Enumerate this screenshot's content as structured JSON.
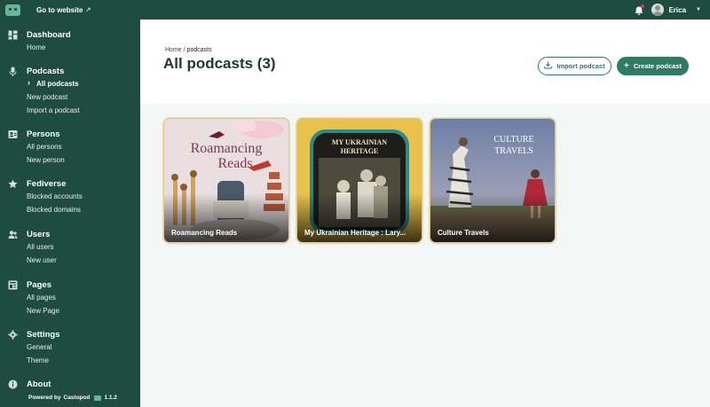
{
  "topbar": {
    "go_to_website": "Go to website",
    "user_name": "Erica"
  },
  "sidebar": {
    "sections": [
      {
        "title": "Dashboard",
        "icon": "dashboard-icon",
        "items": [
          "Home"
        ]
      },
      {
        "title": "Podcasts",
        "icon": "microphone-icon",
        "items": [
          "All podcasts",
          "New podcast",
          "Import a podcast"
        ],
        "active": "All podcasts"
      },
      {
        "title": "Persons",
        "icon": "person-card-icon",
        "items": [
          "All persons",
          "New person"
        ]
      },
      {
        "title": "Fediverse",
        "icon": "star-icon",
        "items": [
          "Blocked accounts",
          "Blocked domains"
        ]
      },
      {
        "title": "Users",
        "icon": "users-icon",
        "items": [
          "All users",
          "New user"
        ]
      },
      {
        "title": "Pages",
        "icon": "pages-icon",
        "items": [
          "All pages",
          "New Page"
        ]
      },
      {
        "title": "Settings",
        "icon": "gear-icon",
        "items": [
          "General",
          "Theme"
        ]
      },
      {
        "title": "About",
        "icon": "info-icon",
        "items": []
      }
    ],
    "powered_by": "Powered by",
    "brand": "Castopod",
    "version": "1.1.2"
  },
  "header": {
    "breadcrumb": [
      "Home",
      "podcasts"
    ],
    "breadcrumb_sep": "/",
    "title": "All podcasts (3)",
    "import_button": "Import podcast",
    "create_button": "Create podcast"
  },
  "podcasts": [
    {
      "title": "Roamancing Reads"
    },
    {
      "title": "My Ukrainian Heritage : Lary..."
    },
    {
      "title": "Culture Travels"
    }
  ],
  "colors": {
    "sidebar": "#1e4d3f",
    "accent": "#2f7a64",
    "logo": "#64b79b",
    "card_border": "#e7c97f",
    "notification": "#e23b3b"
  }
}
